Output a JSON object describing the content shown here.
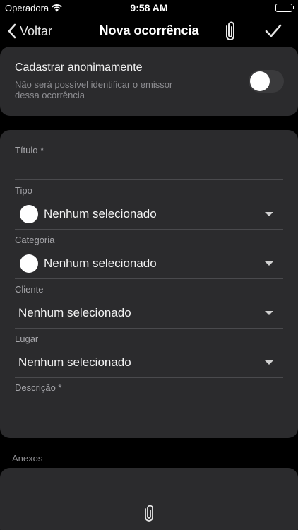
{
  "status_bar": {
    "carrier": "Operadora",
    "time": "9:58 AM",
    "icons": [
      "wifi-icon",
      "battery-icon"
    ]
  },
  "nav": {
    "back_label": "Voltar",
    "title": "Nova ocorrência",
    "icons": [
      "chevron-left-icon",
      "paperclip-icon",
      "checkmark-icon"
    ]
  },
  "anonymous": {
    "title": "Cadastrar anonimamente",
    "description": "Não será possível identificar o emissor dessa ocorrência",
    "enabled": false
  },
  "form": {
    "titulo_label": "Título *",
    "titulo_value": "",
    "tipo_label": "Tipo",
    "tipo_value": "Nenhum selecionado",
    "categoria_label": "Categoria",
    "categoria_value": "Nenhum selecionado",
    "cliente_label": "Cliente",
    "cliente_value": "Nenhum selecionado",
    "lugar_label": "Lugar",
    "lugar_value": "Nenhum selecionado",
    "descricao_label": "Descrição *",
    "descricao_value": ""
  },
  "attachments": {
    "label": "Anexos",
    "icon": "paperclip-icon"
  },
  "colors": {
    "background": "#000000",
    "card": "#2b2b2d",
    "label": "#a6a6aa",
    "text": "#f2f2f2"
  }
}
